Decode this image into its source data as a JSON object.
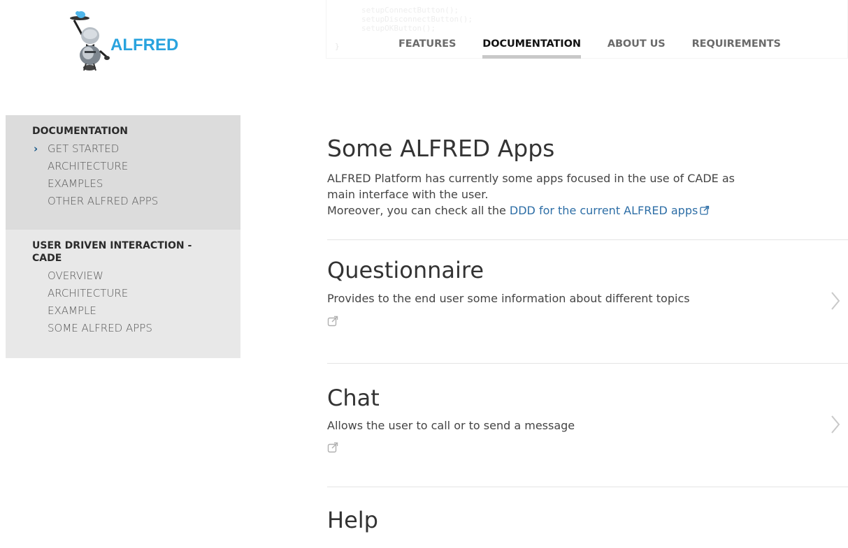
{
  "brand": {
    "name": "ALFRED",
    "accent": "#29a3de"
  },
  "code_background": [
    "setupConnectButton();",
    "setupDisconnectButton();",
    "setupOKButton();"
  ],
  "nav": {
    "items": [
      {
        "label": "FEATURES",
        "active": false
      },
      {
        "label": "DOCUMENTATION",
        "active": true
      },
      {
        "label": "ABOUT US",
        "active": false
      },
      {
        "label": "REQUIREMENTS",
        "active": false
      }
    ]
  },
  "sidebar": {
    "sections": [
      {
        "heading": "DOCUMENTATION",
        "items": [
          {
            "label": "GET STARTED",
            "current": true
          },
          {
            "label": "ARCHITECTURE",
            "current": false
          },
          {
            "label": "EXAMPLES",
            "current": false
          },
          {
            "label": "OTHER ALFRED APPS",
            "current": false
          }
        ]
      },
      {
        "heading": "USER DRIVEN INTERACTION - CADE",
        "items": [
          {
            "label": "OVERVIEW",
            "current": false
          },
          {
            "label": "ARCHITECTURE",
            "current": false
          },
          {
            "label": "EXAMPLE",
            "current": false
          },
          {
            "label": "SOME ALFRED APPS",
            "current": false
          }
        ]
      }
    ]
  },
  "main": {
    "title": "Some ALFRED Apps",
    "intro_line1": "ALFRED Platform has currently some apps focused in the use of CADE as main interface with the user.",
    "intro_line2_prefix": "Moreover, you can check all the ",
    "intro_link": "DDD for the current ALFRED apps",
    "link_color": "#2d6ea6",
    "apps": [
      {
        "title": "Questionnaire",
        "description": "Provides to the end user some information about different topics"
      },
      {
        "title": "Chat",
        "description": "Allows the user to call or to send a message"
      },
      {
        "title": "Help",
        "description": ""
      }
    ]
  }
}
